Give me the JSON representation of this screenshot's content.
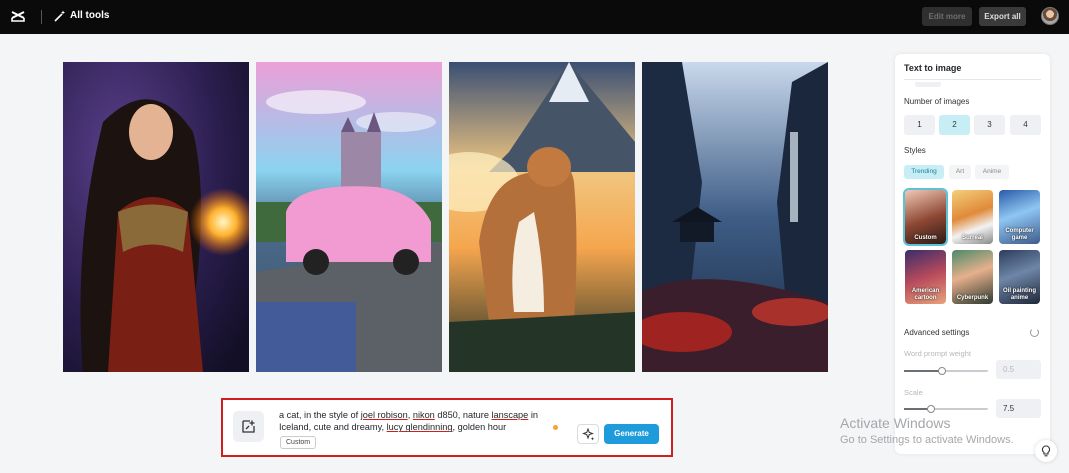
{
  "topbar": {
    "tools_label": "All tools",
    "edit_more_label": "Edit more",
    "export_all_label": "Export all"
  },
  "gallery": {
    "images": [
      {
        "icon": "fantasy-warrior-woman-image"
      },
      {
        "icon": "pink-car-castle-image"
      },
      {
        "icon": "cat-mountain-image"
      },
      {
        "icon": "misty-valley-temple-image"
      }
    ]
  },
  "prompt": {
    "text_1": "a cat, in the style of ",
    "u1": "joel robison",
    "text_2": ", ",
    "u2": "nikon",
    "text_3": " d850, nature ",
    "u3": "lanscape",
    "text_4": " in Iceland, cute and dreamy, ",
    "u4": "lucy glendinning",
    "text_5": ", golden hour",
    "style_chip": "Custom",
    "generate_label": "Generate"
  },
  "panel": {
    "title": "Text to image",
    "number_label": "Number of images",
    "counts": [
      "1",
      "2",
      "3",
      "4"
    ],
    "selected_count": "2",
    "styles_label": "Styles",
    "style_tabs": [
      "Trending",
      "Art",
      "Anime"
    ],
    "style_cards": [
      "Custom",
      "Surreal",
      "Computer game",
      "American cartoon",
      "Cyberpunk",
      "Oil painting anime"
    ],
    "selected_style": "Custom",
    "advanced_label": "Advanced settings",
    "word_weight_label": "Word prompt weight",
    "word_weight_value": "0.5",
    "word_weight_level": 0.45,
    "scale_label": "Scale",
    "scale_value": "7.5",
    "scale_level": 0.32
  },
  "watermark": {
    "line1": "Activate Windows",
    "line2": "Go to Settings to activate Windows."
  },
  "colors": {
    "accent": "#1e9bdb",
    "selected_bg": "#c8eef5",
    "highlight_border": "#d0201e"
  }
}
